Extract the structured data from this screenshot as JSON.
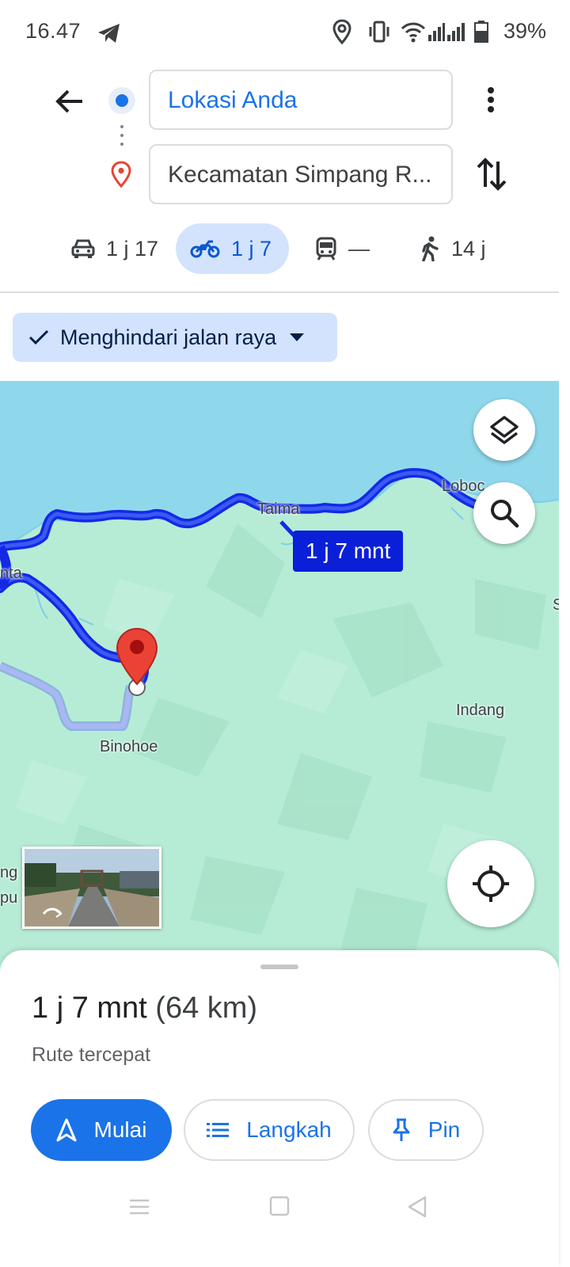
{
  "status_bar": {
    "time": "16.47",
    "battery_percent": "39%",
    "icons": [
      "telegram-icon",
      "location-icon",
      "vibrate-icon",
      "wifi-icon",
      "signal-icon",
      "signal-icon",
      "battery-icon"
    ]
  },
  "directions": {
    "origin": "Lokasi Anda",
    "destination": "Kecamatan Simpang R...",
    "modes": [
      {
        "icon": "car-icon",
        "label": "1 j 17",
        "selected": false
      },
      {
        "icon": "motorcycle-icon",
        "label": "1 j 7",
        "selected": true
      },
      {
        "icon": "transit-icon",
        "label": "—",
        "selected": false
      },
      {
        "icon": "walk-icon",
        "label": "14 j",
        "selected": false
      }
    ],
    "filter_chip": "Menghindari jalan raya"
  },
  "map": {
    "places": [
      "Taima",
      "Loboc",
      "nta",
      "Binohoe",
      "Indang",
      "S",
      "ng",
      "pu"
    ],
    "eta_label": "1 j 7 mnt",
    "colors": {
      "water": "#8fd8ec",
      "land": "#b6ecd6",
      "route": "#1329e6",
      "alt_route": "#a9b7f2",
      "marker": "#ea4335"
    }
  },
  "sheet": {
    "duration": "1 j 7 mnt",
    "distance": "(64 km)",
    "subtitle": "Rute tercepat",
    "buttons": {
      "start": "Mulai",
      "steps": "Langkah",
      "pin": "Pin"
    }
  },
  "colors": {
    "accent": "#1a73e8",
    "chip_bg": "#d3e3fd"
  }
}
